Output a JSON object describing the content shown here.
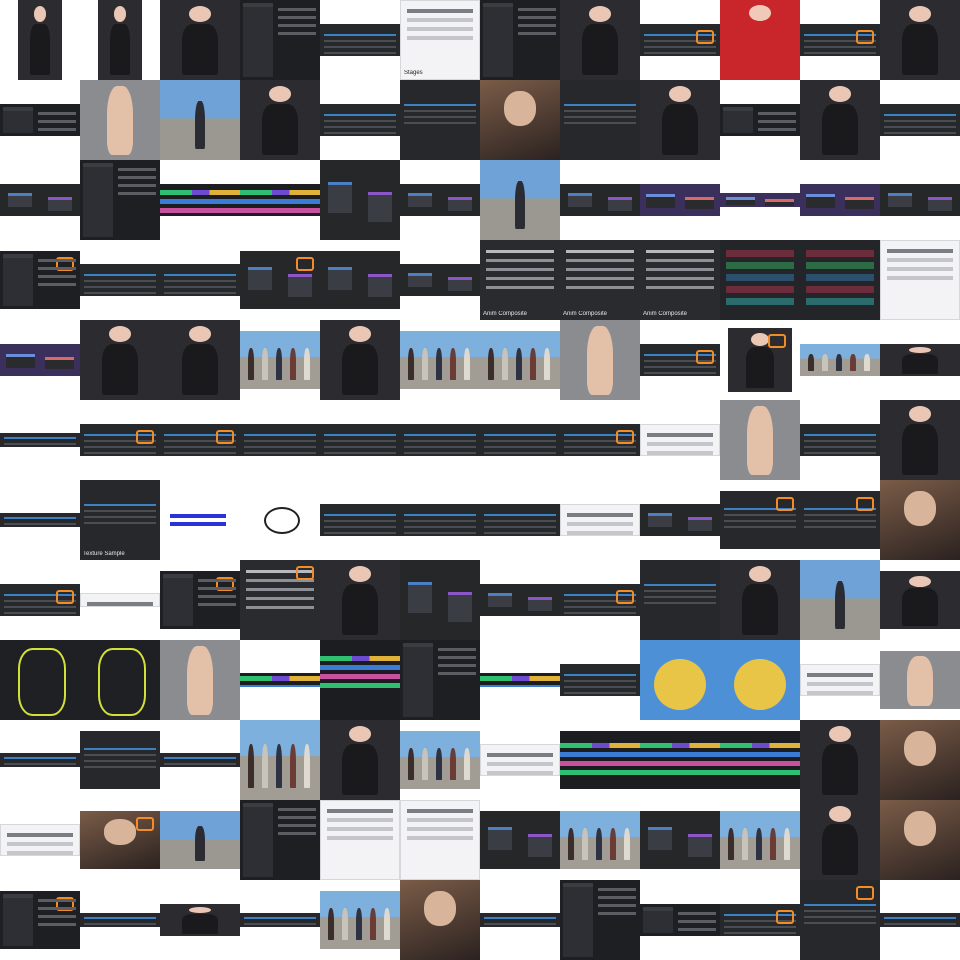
{
  "grid": {
    "columns": 12,
    "rows": 12
  },
  "rows": [
    {
      "tiles": [
        {
          "kind": "character",
          "size": "tall"
        },
        {
          "kind": "character",
          "size": "tall"
        },
        {
          "kind": "character",
          "size": "full"
        },
        {
          "kind": "panel",
          "size": "full"
        },
        {
          "kind": "dark",
          "size": "strip"
        },
        {
          "kind": "light",
          "size": "full",
          "text": "Stages"
        },
        {
          "kind": "panel",
          "size": "full"
        },
        {
          "kind": "character",
          "size": "full"
        },
        {
          "kind": "dark",
          "size": "strip",
          "mark": true
        },
        {
          "kind": "red",
          "size": "full"
        },
        {
          "kind": "dark",
          "size": "strip",
          "mark": true
        },
        {
          "kind": "character",
          "size": "full"
        }
      ]
    },
    {
      "tiles": [
        {
          "kind": "panel",
          "size": "strip"
        },
        {
          "kind": "skin",
          "size": "full"
        },
        {
          "kind": "viewport",
          "size": "full"
        },
        {
          "kind": "character",
          "size": "full"
        },
        {
          "kind": "dark",
          "size": "strip"
        },
        {
          "kind": "dark",
          "size": "full"
        },
        {
          "kind": "photo",
          "size": "full"
        },
        {
          "kind": "dark",
          "size": "full"
        },
        {
          "kind": "character",
          "size": "full"
        },
        {
          "kind": "panel",
          "size": "strip"
        },
        {
          "kind": "character",
          "size": "full"
        },
        {
          "kind": "dark",
          "size": "strip"
        }
      ]
    },
    {
      "tiles": [
        {
          "kind": "node",
          "size": "strip"
        },
        {
          "kind": "panel",
          "size": "full"
        },
        {
          "kind": "timeline",
          "size": "strip"
        },
        {
          "kind": "timeline",
          "size": "strip"
        },
        {
          "kind": "node",
          "size": "full"
        },
        {
          "kind": "node",
          "size": "strip"
        },
        {
          "kind": "viewport",
          "size": "full"
        },
        {
          "kind": "node",
          "size": "strip"
        },
        {
          "kind": "purple",
          "size": "strip"
        },
        {
          "kind": "purple",
          "size": "thin"
        },
        {
          "kind": "purple",
          "size": "strip"
        },
        {
          "kind": "node",
          "size": "strip"
        }
      ]
    },
    {
      "tiles": [
        {
          "kind": "panel",
          "size": "wide",
          "mark": true
        },
        {
          "kind": "dark",
          "size": "strip"
        },
        {
          "kind": "dark",
          "size": "strip"
        },
        {
          "kind": "node",
          "size": "wide",
          "mark": true
        },
        {
          "kind": "node",
          "size": "wide"
        },
        {
          "kind": "node",
          "size": "strip"
        },
        {
          "kind": "menu",
          "size": "full",
          "text": "Anim Composite"
        },
        {
          "kind": "menu",
          "size": "full",
          "text": "Anim Composite"
        },
        {
          "kind": "menu",
          "size": "full",
          "text": "Anim Composite"
        },
        {
          "kind": "list",
          "size": "full"
        },
        {
          "kind": "list",
          "size": "full"
        },
        {
          "kind": "light",
          "size": "full"
        }
      ]
    },
    {
      "tiles": [
        {
          "kind": "purple",
          "size": "strip"
        },
        {
          "kind": "character",
          "size": "full"
        },
        {
          "kind": "character",
          "size": "full"
        },
        {
          "kind": "crowd",
          "size": "wide"
        },
        {
          "kind": "character",
          "size": "full"
        },
        {
          "kind": "crowd",
          "size": "wide"
        },
        {
          "kind": "crowd",
          "size": "wide"
        },
        {
          "kind": "skin",
          "size": "full"
        },
        {
          "kind": "dark",
          "size": "strip",
          "mark": true
        },
        {
          "kind": "character",
          "size": "sq",
          "mark": true
        },
        {
          "kind": "crowd",
          "size": "strip"
        },
        {
          "kind": "character",
          "size": "strip"
        }
      ]
    },
    {
      "tiles": [
        {
          "kind": "dark",
          "size": "thin"
        },
        {
          "kind": "dark",
          "size": "strip",
          "mark": true
        },
        {
          "kind": "dark",
          "size": "strip",
          "mark": true
        },
        {
          "kind": "dark",
          "size": "strip"
        },
        {
          "kind": "dark",
          "size": "strip"
        },
        {
          "kind": "dark",
          "size": "strip"
        },
        {
          "kind": "dark",
          "size": "strip"
        },
        {
          "kind": "dark",
          "size": "strip",
          "mark": true
        },
        {
          "kind": "light",
          "size": "strip"
        },
        {
          "kind": "skin",
          "size": "full"
        },
        {
          "kind": "dark",
          "size": "strip"
        },
        {
          "kind": "character",
          "size": "full"
        }
      ]
    },
    {
      "tiles": [
        {
          "kind": "dark",
          "size": "thin"
        },
        {
          "kind": "dark",
          "size": "full",
          "text": "Texture Sample"
        },
        {
          "kind": "chart",
          "size": "wide"
        },
        {
          "kind": "face",
          "size": "wide"
        },
        {
          "kind": "dark",
          "size": "strip"
        },
        {
          "kind": "dark",
          "size": "strip"
        },
        {
          "kind": "dark",
          "size": "strip"
        },
        {
          "kind": "light",
          "size": "strip"
        },
        {
          "kind": "node",
          "size": "strip"
        },
        {
          "kind": "dark",
          "size": "wide",
          "mark": true
        },
        {
          "kind": "dark",
          "size": "wide",
          "mark": true
        },
        {
          "kind": "photo",
          "size": "full"
        }
      ]
    },
    {
      "tiles": [
        {
          "kind": "dark",
          "size": "strip",
          "mark": true
        },
        {
          "kind": "light",
          "size": "thin"
        },
        {
          "kind": "panel",
          "size": "wide",
          "mark": true
        },
        {
          "kind": "menu",
          "size": "full",
          "mark": true
        },
        {
          "kind": "character",
          "size": "full"
        },
        {
          "kind": "node",
          "size": "full"
        },
        {
          "kind": "node",
          "size": "strip"
        },
        {
          "kind": "dark",
          "size": "strip",
          "mark": true
        },
        {
          "kind": "dark",
          "size": "full"
        },
        {
          "kind": "character",
          "size": "full"
        },
        {
          "kind": "viewport",
          "size": "full"
        },
        {
          "kind": "character",
          "size": "wide"
        }
      ]
    },
    {
      "tiles": [
        {
          "kind": "yellow",
          "size": "full"
        },
        {
          "kind": "yellow",
          "size": "full"
        },
        {
          "kind": "skin",
          "size": "full"
        },
        {
          "kind": "timeline",
          "size": "thin"
        },
        {
          "kind": "timeline",
          "size": "full"
        },
        {
          "kind": "panel",
          "size": "full"
        },
        {
          "kind": "timeline",
          "size": "thin"
        },
        {
          "kind": "dark",
          "size": "strip"
        },
        {
          "kind": "blue",
          "size": "full"
        },
        {
          "kind": "blue",
          "size": "full"
        },
        {
          "kind": "light",
          "size": "strip"
        },
        {
          "kind": "skin",
          "size": "wide"
        }
      ]
    },
    {
      "tiles": [
        {
          "kind": "dark",
          "size": "thin"
        },
        {
          "kind": "dark",
          "size": "wide"
        },
        {
          "kind": "dark",
          "size": "thin"
        },
        {
          "kind": "crowd",
          "size": "full"
        },
        {
          "kind": "character",
          "size": "full"
        },
        {
          "kind": "crowd",
          "size": "wide"
        },
        {
          "kind": "light",
          "size": "strip"
        },
        {
          "kind": "timeline",
          "size": "wide"
        },
        {
          "kind": "timeline",
          "size": "wide"
        },
        {
          "kind": "timeline",
          "size": "wide"
        },
        {
          "kind": "character",
          "size": "full"
        },
        {
          "kind": "photo",
          "size": "full"
        }
      ]
    },
    {
      "tiles": [
        {
          "kind": "light",
          "size": "strip"
        },
        {
          "kind": "photo",
          "size": "wide",
          "mark": true
        },
        {
          "kind": "viewport",
          "size": "wide"
        },
        {
          "kind": "panel",
          "size": "full"
        },
        {
          "kind": "light",
          "size": "full"
        },
        {
          "kind": "light",
          "size": "full"
        },
        {
          "kind": "node",
          "size": "wide"
        },
        {
          "kind": "crowd",
          "size": "wide"
        },
        {
          "kind": "node",
          "size": "wide"
        },
        {
          "kind": "crowd",
          "size": "wide"
        },
        {
          "kind": "character",
          "size": "full"
        },
        {
          "kind": "photo",
          "size": "full"
        }
      ]
    },
    {
      "tiles": [
        {
          "kind": "panel",
          "size": "wide",
          "mark": true
        },
        {
          "kind": "dark",
          "size": "thin"
        },
        {
          "kind": "character",
          "size": "strip"
        },
        {
          "kind": "dark",
          "size": "thin"
        },
        {
          "kind": "crowd",
          "size": "wide"
        },
        {
          "kind": "photo",
          "size": "full"
        },
        {
          "kind": "dark",
          "size": "thin"
        },
        {
          "kind": "panel",
          "size": "full"
        },
        {
          "kind": "panel",
          "size": "strip"
        },
        {
          "kind": "dark",
          "size": "strip",
          "mark": true
        },
        {
          "kind": "dark",
          "size": "full",
          "mark": true
        },
        {
          "kind": "dark",
          "size": "thin"
        }
      ]
    }
  ]
}
